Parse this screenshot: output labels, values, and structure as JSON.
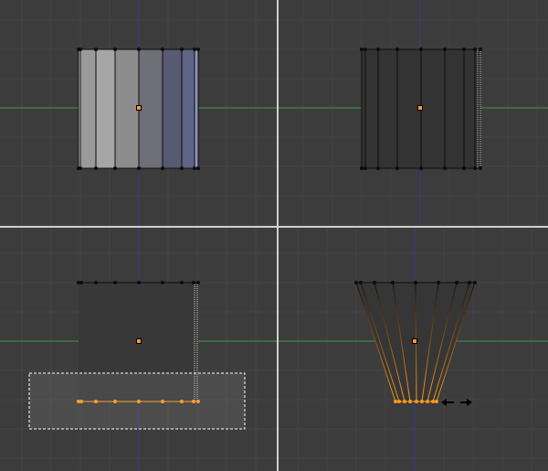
{
  "viewports": [
    {
      "name": "top-left",
      "mode": "object-shaded"
    },
    {
      "name": "top-right",
      "mode": "edit-wireframe"
    },
    {
      "name": "bottom-left",
      "mode": "edit-box-select"
    },
    {
      "name": "bottom-right",
      "mode": "edit-scale"
    }
  ],
  "colors": {
    "background": "#3c3c3c",
    "grid": "#434343",
    "divider": "#d0d0d0",
    "x_axis": "#3f9a3f",
    "z_axis": "#3a3a8a",
    "wire": "#0c0c0c",
    "selected": "#ff9a1e",
    "origin": "#ff9933"
  },
  "cursor_icon": "scale-arrows-icon"
}
